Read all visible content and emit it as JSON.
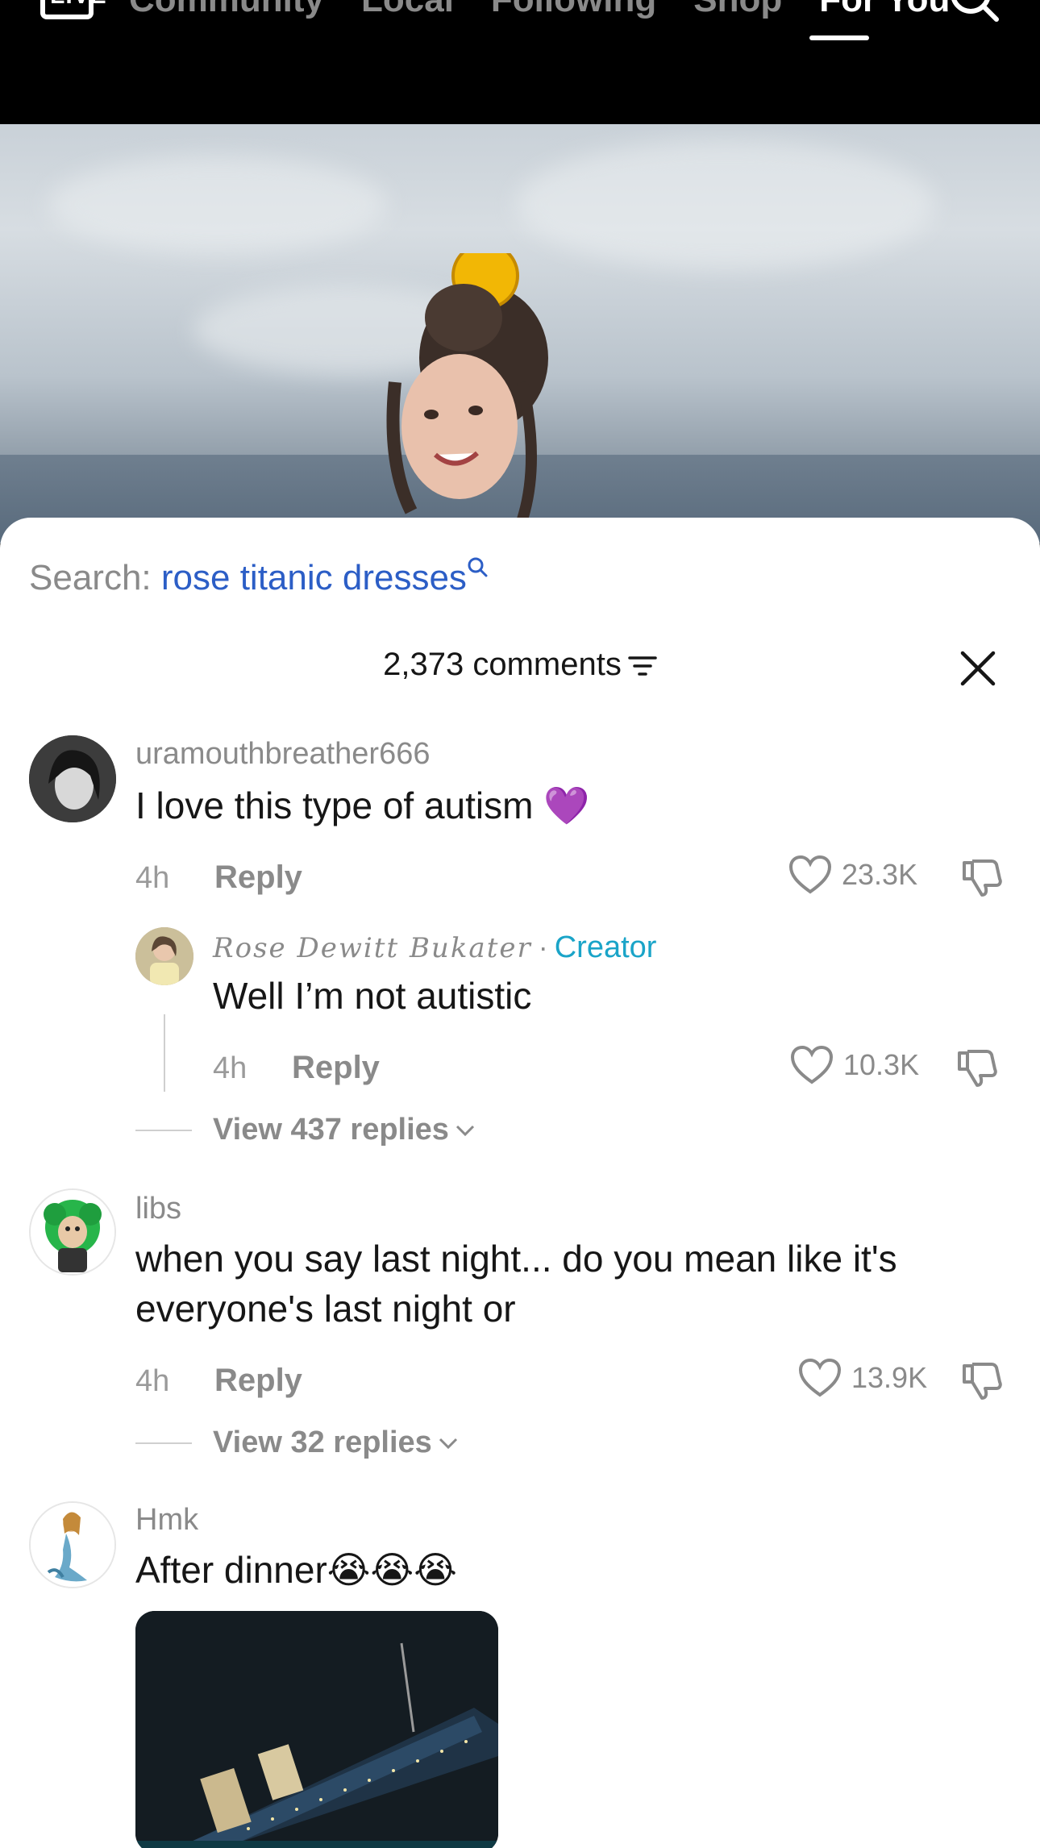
{
  "nav": {
    "live_label": "LIVE",
    "tabs": [
      "Community",
      "Local",
      "Following",
      "Shop",
      "For You"
    ],
    "active_tab": "For You"
  },
  "search": {
    "label": "Search:",
    "term": "rose titanic dresses"
  },
  "comments_header": {
    "count_label": "2,373 comments"
  },
  "comments": [
    {
      "username": "uramouthbreather666",
      "text": "I love this type of autism 💜",
      "time": "4h",
      "reply_label": "Reply",
      "likes": "23.3K",
      "reply": {
        "username": "Rose Dewitt Bukater",
        "separator": "·",
        "badge": "Creator",
        "text": "Well I’m not autistic",
        "time": "4h",
        "reply_label": "Reply",
        "likes": "10.3K"
      },
      "view_replies": "View 437 replies"
    },
    {
      "username": "libs",
      "text": "when you say last night... do you mean like it's everyone's last night or",
      "time": "4h",
      "reply_label": "Reply",
      "likes": "13.9K",
      "view_replies": "View 32 replies"
    },
    {
      "username": "Hmk",
      "text": "After dinner😭😭😭"
    }
  ],
  "colors": {
    "link_blue": "#2c5ec6",
    "creator_teal": "#1aa4c8",
    "muted_gray": "#8a8a8a"
  }
}
